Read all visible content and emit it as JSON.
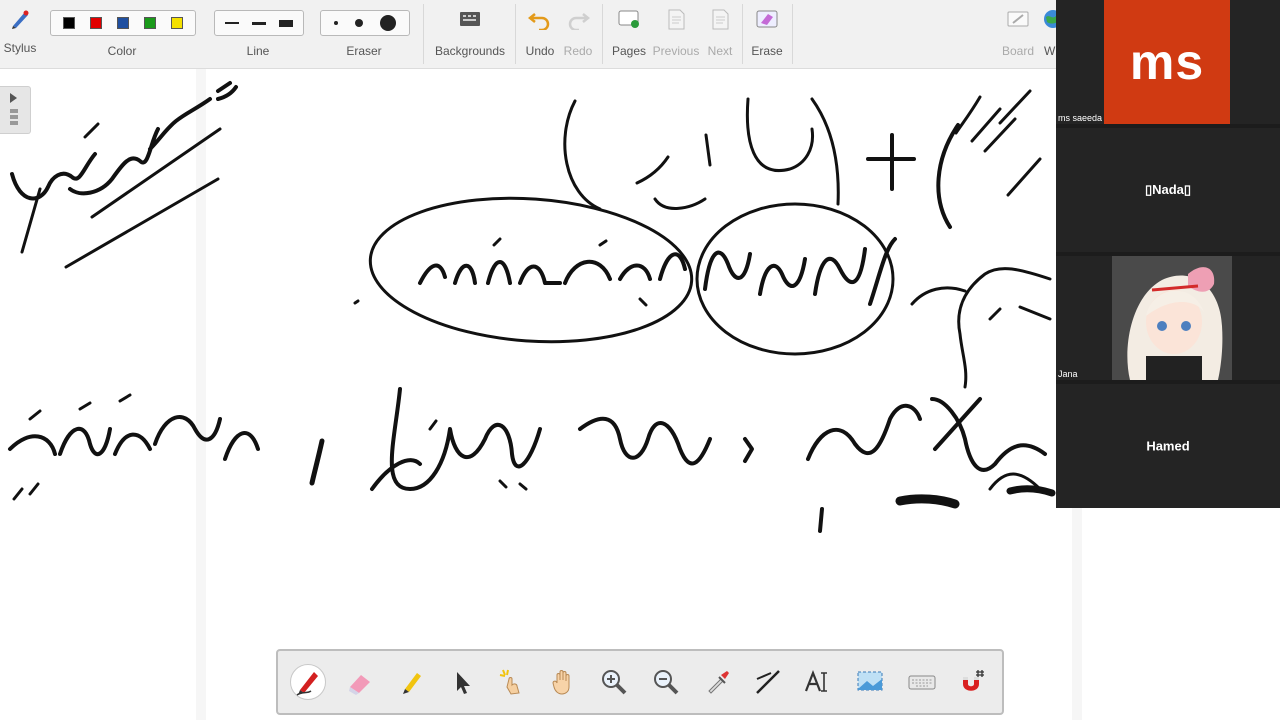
{
  "toolbar": {
    "stylus_label": "Stylus",
    "color_label": "Color",
    "line_label": "Line",
    "eraser_label": "Eraser",
    "backgrounds_label": "Backgrounds",
    "undo_label": "Undo",
    "redo_label": "Redo",
    "pages_label": "Pages",
    "previous_label": "Previous",
    "next_label": "Next",
    "erase_label": "Erase",
    "board_label": "Board",
    "web_label": "W",
    "colors": [
      "#000000",
      "#e00000",
      "#1f4fa0",
      "#1a9a1a",
      "#f4e000"
    ]
  },
  "participants": {
    "tile1_logo": "ms",
    "tile1_name": "ms saeeda",
    "tile1_brand_color": "#d03a12",
    "tile2_name": "▯Nada▯",
    "tile3_name": "Jana",
    "tile4_name": "Hamed"
  },
  "bottom_tools": [
    "pen-tool-icon",
    "eraser-tool-icon",
    "highlighter-icon",
    "pointer-icon",
    "laser-pointer-icon",
    "hand-pan-icon",
    "zoom-in-icon",
    "zoom-out-icon",
    "pipette-icon",
    "line-tool-icon",
    "text-tool-icon",
    "screen-capture-icon",
    "keyboard-icon",
    "magnet-snap-icon"
  ]
}
